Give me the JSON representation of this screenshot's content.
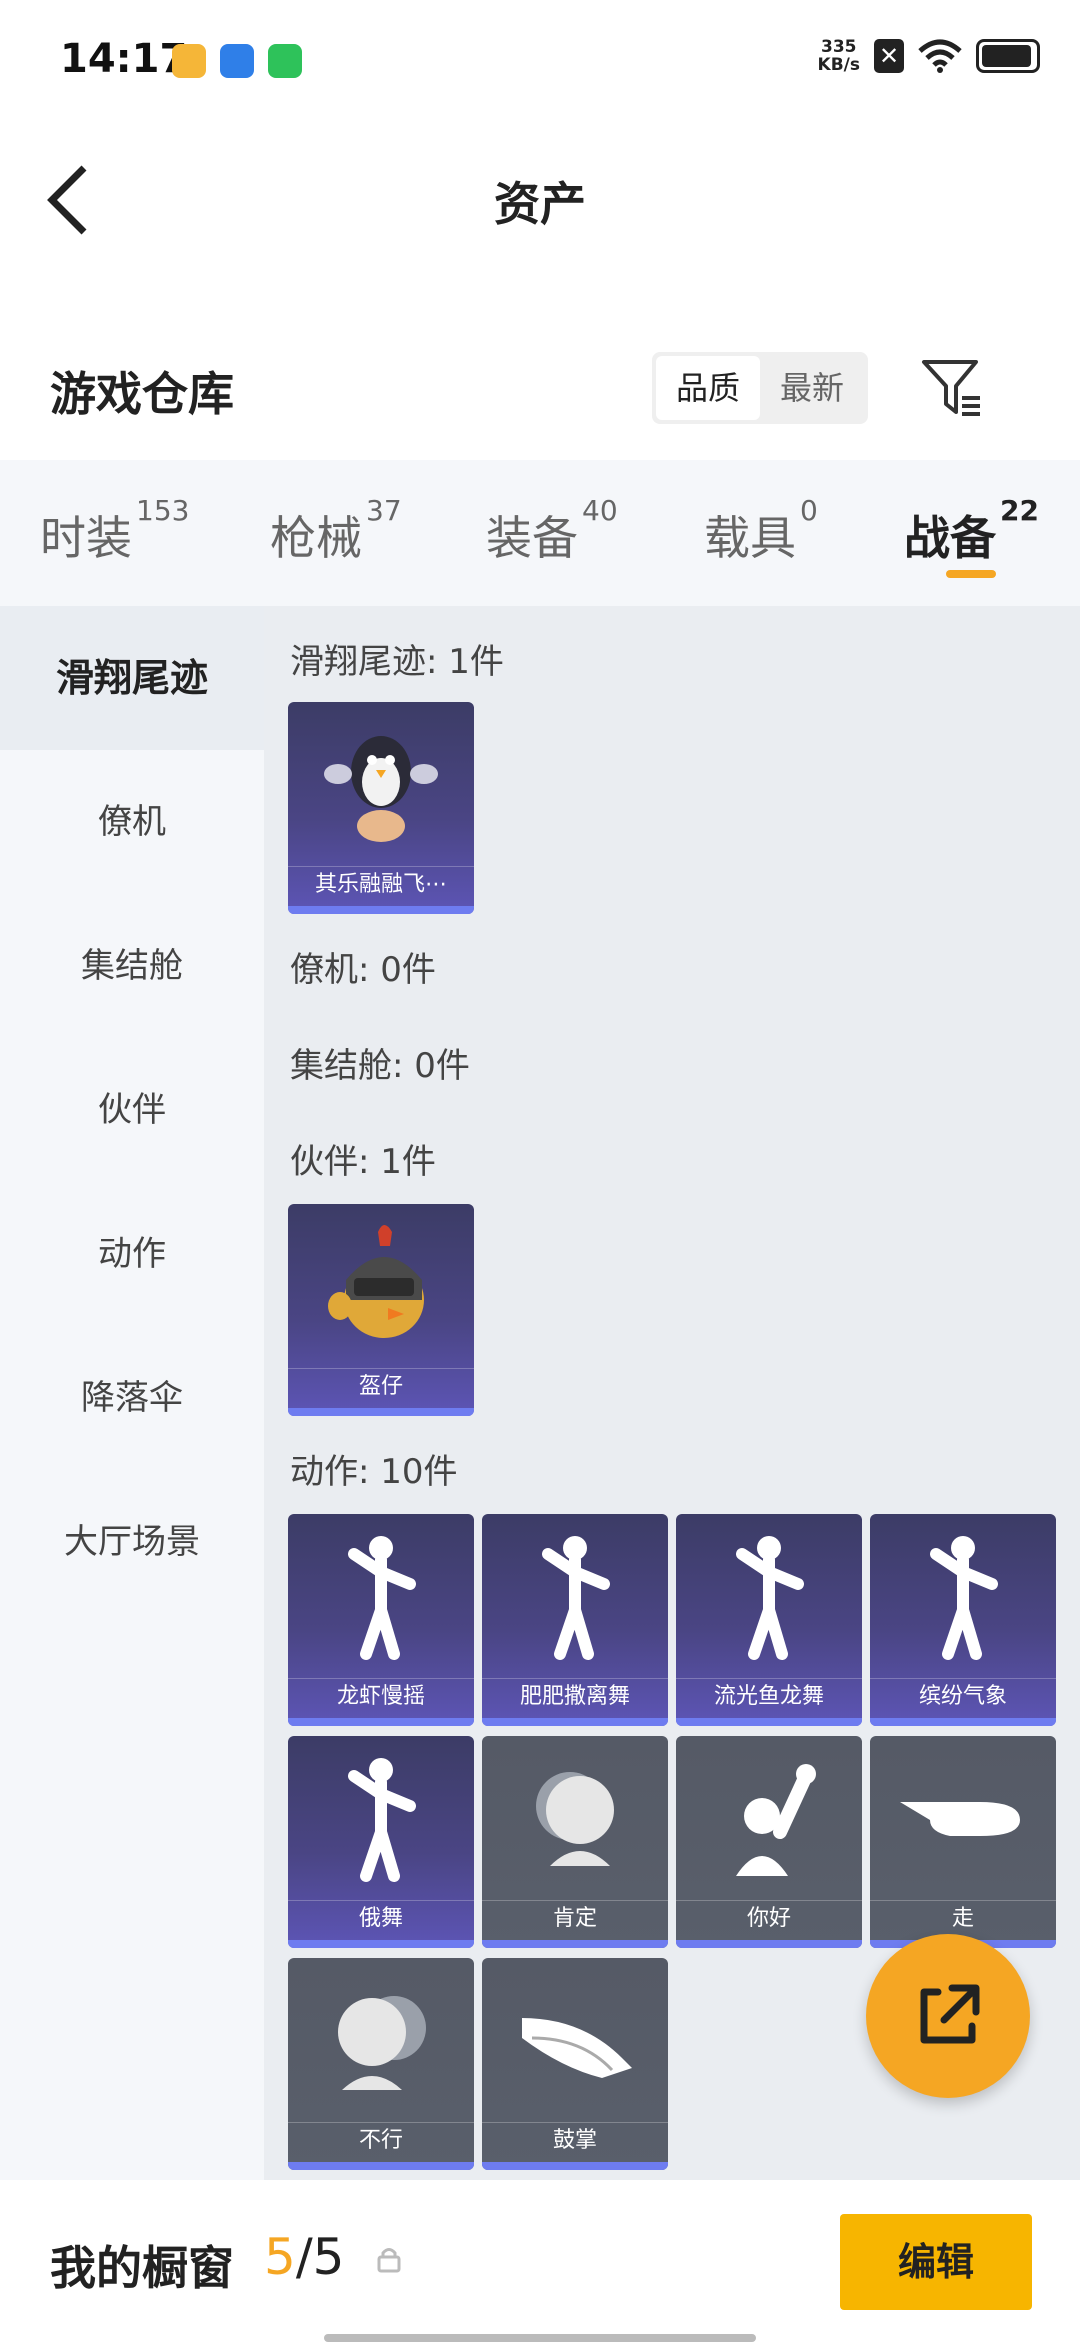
{
  "status_bar": {
    "time": "14:17",
    "net_speed_value": "335",
    "net_speed_unit": "KB/s",
    "x_glyph": "✕",
    "battery_level_pct": 85,
    "app_icons": [
      {
        "name": "bulb-app-icon",
        "color": "#f5b638"
      },
      {
        "name": "browser-app-icon",
        "color": "#2f7fe8"
      },
      {
        "name": "wechat-icon",
        "color": "#2ec25a"
      }
    ]
  },
  "header": {
    "title": "资产"
  },
  "warehouse": {
    "title": "游戏仓库",
    "sort_options": [
      {
        "label": "品质",
        "active": true
      },
      {
        "label": "最新",
        "active": false
      }
    ]
  },
  "tabs": [
    {
      "label": "时装",
      "count": "153",
      "active": false
    },
    {
      "label": "枪械",
      "count": "37",
      "active": false
    },
    {
      "label": "装备",
      "count": "40",
      "active": false
    },
    {
      "label": "载具",
      "count": "0",
      "active": false
    },
    {
      "label": "战备",
      "count": "22",
      "active": true
    }
  ],
  "sidebar": {
    "items": [
      {
        "label": "滑翔尾迹",
        "active": true
      },
      {
        "label": "僚机",
        "active": false
      },
      {
        "label": "集结舱",
        "active": false
      },
      {
        "label": "伙伴",
        "active": false
      },
      {
        "label": "动作",
        "active": false
      },
      {
        "label": "降落伞",
        "active": false
      },
      {
        "label": "大厅场景",
        "active": false
      }
    ]
  },
  "sections": [
    {
      "title": "滑翔尾迹: 1件",
      "items": [
        {
          "name": "其乐融融飞⋯",
          "style": "purple",
          "icon": "penguin-icon"
        }
      ]
    },
    {
      "title": "僚机: 0件",
      "items": []
    },
    {
      "title": "集结舱: 0件",
      "items": []
    },
    {
      "title": "伙伴: 1件",
      "items": [
        {
          "name": "盔仔",
          "style": "purple",
          "icon": "helmet-chick-icon"
        }
      ]
    },
    {
      "title": "动作: 10件",
      "items": [
        {
          "name": "龙虾慢摇",
          "style": "purple",
          "icon": "dance-figure-icon"
        },
        {
          "name": "肥肥撒离舞",
          "style": "purple",
          "icon": "dance-figure-icon"
        },
        {
          "name": "流光鱼龙舞",
          "style": "purple",
          "icon": "dance-figure-icon"
        },
        {
          "name": "缤纷气象",
          "style": "purple",
          "icon": "dance-figure-icon"
        },
        {
          "name": "俄舞",
          "style": "purple",
          "icon": "dance-figure-icon"
        },
        {
          "name": "肯定",
          "style": "gray",
          "icon": "nod-head-icon"
        },
        {
          "name": "你好",
          "style": "gray",
          "icon": "wave-hand-icon"
        },
        {
          "name": "走",
          "style": "gray",
          "icon": "point-hand-icon"
        },
        {
          "name": "不行",
          "style": "gray",
          "icon": "shake-head-icon"
        },
        {
          "name": "鼓掌",
          "style": "gray",
          "icon": "clap-hands-icon"
        }
      ]
    }
  ],
  "showcase": {
    "title": "我的橱窗",
    "current": "5",
    "separator": "/",
    "total": "5",
    "edit_label": "编辑"
  },
  "colors": {
    "accent": "#f5a623",
    "edit_button": "#f7b500",
    "card_bar": "#6e7cf0"
  }
}
